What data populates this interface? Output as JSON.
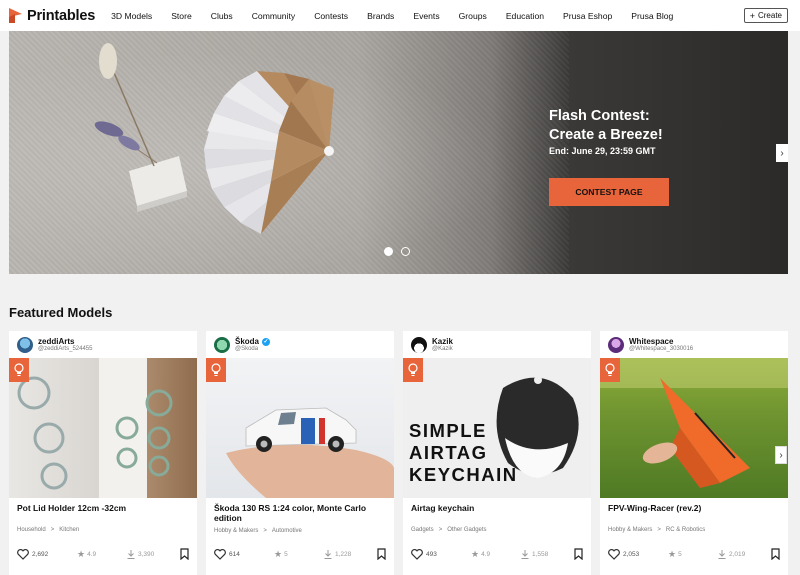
{
  "nav": {
    "logo": "Printables",
    "links": [
      "3D Models",
      "Store",
      "Clubs",
      "Community",
      "Contests",
      "Brands",
      "Events",
      "Groups",
      "Education",
      "Prusa Eshop",
      "Prusa Blog"
    ],
    "create_label": "Create"
  },
  "hero": {
    "title_line1": "Flash Contest:",
    "title_line2": "Create a Breeze!",
    "date": "End: June 29, 23:59 GMT",
    "button_label": "CONTEST PAGE",
    "slides": 2,
    "active_slide": 1
  },
  "featured": {
    "title": "Featured Models",
    "cards": [
      {
        "author": "zeddiArts",
        "handle": "@zeddiArts_524455",
        "verified": false,
        "title": "Pot Lid Holder 12cm -32cm",
        "category": "Household",
        "subcategory": "Kitchen",
        "likes": "2,692",
        "rating": "4.9",
        "downloads": "3,390"
      },
      {
        "author": "Škoda",
        "handle": "@Skoda",
        "verified": true,
        "title": "Škoda 130 RS 1:24 color, Monte Carlo edition",
        "category": "Hobby & Makers",
        "subcategory": "Automotive",
        "likes": "614",
        "rating": "5",
        "downloads": "1,228"
      },
      {
        "author": "Kazik",
        "handle": "@Kazik",
        "verified": false,
        "title": "Airtag keychain",
        "category": "Gadgets",
        "subcategory": "Other Gadgets",
        "likes": "493",
        "rating": "4.9",
        "downloads": "1,558",
        "image_text": [
          "SIMPLE",
          "AIRTAG",
          "KEYCHAIN"
        ]
      },
      {
        "author": "Whitespace",
        "handle": "@Whitespace_3030016",
        "verified": false,
        "title": "FPV-Wing-Racer (rev.2)",
        "category": "Hobby & Makers",
        "subcategory": "RC & Robotics",
        "likes": "2,053",
        "rating": "5",
        "downloads": "2,019"
      }
    ]
  },
  "colors": {
    "accent": "#e8643b",
    "verified": "#1da1f2"
  },
  "icons": [
    "printables-logo-icon",
    "plus-icon",
    "chevron-right-icon",
    "lightbulb-icon",
    "heart-icon",
    "star-icon",
    "download-icon",
    "bookmark-icon",
    "verified-icon"
  ]
}
